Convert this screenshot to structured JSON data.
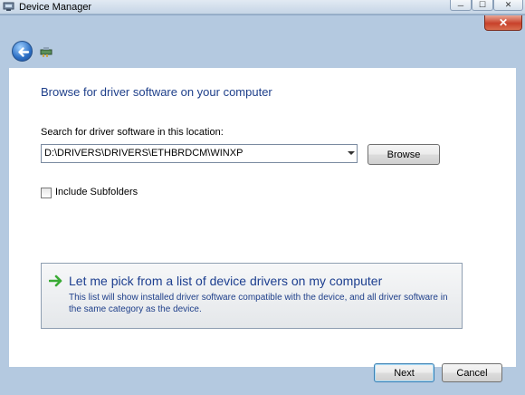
{
  "window": {
    "title": "Device Manager",
    "controls": {
      "minimize": "─",
      "maximize": "☐",
      "close": "✕"
    }
  },
  "dialog": {
    "close": "✕",
    "heading": "Browse for driver software on your computer",
    "search": {
      "label": "Search for driver software in this location:",
      "path_value": "D:\\DRIVERS\\DRIVERS\\ETHBRDCM\\WINXP",
      "browse_label": "Browse"
    },
    "include_subfolders": {
      "label": "Include Subfolders",
      "checked": false
    },
    "command_link": {
      "title": "Let me pick from a list of device drivers on my computer",
      "description": "This list will show installed driver software compatible with the device, and all driver software in the same category as the device."
    },
    "buttons": {
      "next": "Next",
      "cancel": "Cancel"
    }
  },
  "icons": {
    "back": "back-arrow-icon",
    "wizard": "device-driver-icon",
    "command_link": "green-arrow-icon",
    "app": "device-manager-icon"
  },
  "colors": {
    "heading": "#1e3f8a",
    "command_title": "#1c3e8f",
    "close_button": "#c8412a",
    "back_button": "#2d6fc4",
    "command_arrow": "#3aaa35"
  }
}
